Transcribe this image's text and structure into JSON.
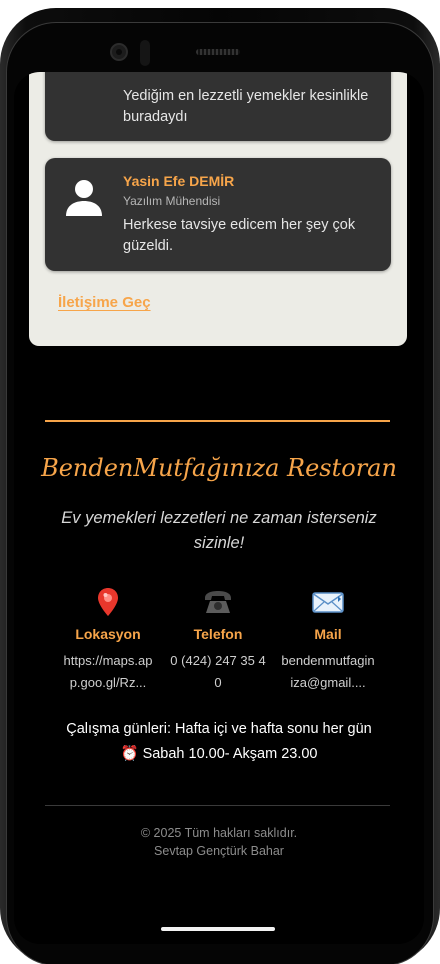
{
  "reviews": [
    {
      "name": "",
      "role": "",
      "text": "Yediğim en lezzetli yemekler kesinlikle buradaydı"
    },
    {
      "name": "Yasin Efe DEMİR",
      "role": "Yazılım Mühendisi",
      "text": "Herkese tavsiye edicem her şey çok güzeldi."
    }
  ],
  "contact_link": "İletişime Geç",
  "footer": {
    "brand": "BendenMutfağınıza Restoran",
    "tagline": "Ev yemekleri lezzetleri ne zaman isterseniz sizinle!",
    "contacts": [
      {
        "icon": "location-pin-icon",
        "label": "Lokasyon",
        "value": "https://maps.app.goo.gl/Rz..."
      },
      {
        "icon": "telephone-icon",
        "label": "Telefon",
        "value": "0 (424) 247 35 40"
      },
      {
        "icon": "email-icon",
        "label": "Mail",
        "value": "bendenmutfaginiza@gmail...."
      }
    ],
    "hours_line1": "Çalışma günleri: Hafta içi ve hafta sonu her gün",
    "hours_line2": "⏰ Sabah 10.00- Akşam 23.00",
    "copyright": "© 2025 Tüm hakları saklıdır.",
    "author": "Sevtap Gençtürk Bahar"
  },
  "colors": {
    "accent": "#f7a54a",
    "panel": "#ecece6",
    "card": "#323232",
    "background": "#000000"
  }
}
